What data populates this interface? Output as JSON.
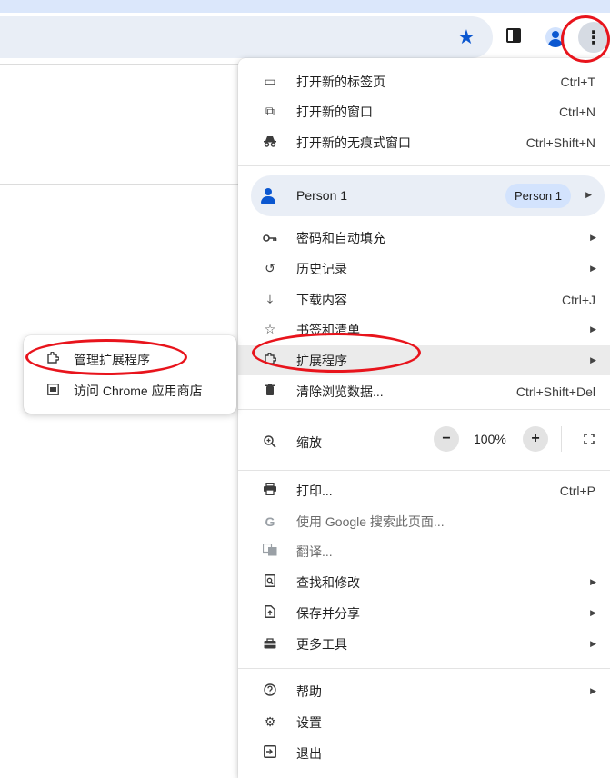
{
  "toolbar": {
    "bookmark_star_icon": "star-icon",
    "side_panel_icon": "side-panel-icon",
    "profile_icon": "profile-avatar-icon",
    "menu_icon": "more-vert-icon",
    "menu_glyph": "⋮",
    "accent": "#0b57d0"
  },
  "menu": {
    "new_tab": {
      "label": "打开新的标签页",
      "shortcut": "Ctrl+T"
    },
    "new_window": {
      "label": "打开新的窗口",
      "shortcut": "Ctrl+N"
    },
    "new_incognito": {
      "label": "打开新的无痕式窗口",
      "shortcut": "Ctrl+Shift+N"
    },
    "person": {
      "name": "Person 1",
      "chip": "Person 1"
    },
    "passwords": {
      "label": "密码和自动填充"
    },
    "history": {
      "label": "历史记录"
    },
    "downloads": {
      "label": "下载内容",
      "shortcut": "Ctrl+J"
    },
    "bookmarks": {
      "label": "书签和清单"
    },
    "extensions": {
      "label": "扩展程序"
    },
    "clear_data": {
      "label": "清除浏览数据...",
      "shortcut": "Ctrl+Shift+Del"
    },
    "zoom": {
      "label": "缩放",
      "minus": "−",
      "value": "100%",
      "plus": "+"
    },
    "print": {
      "label": "打印...",
      "shortcut": "Ctrl+P"
    },
    "google_search": {
      "label": "使用 Google 搜索此页面..."
    },
    "translate": {
      "label": "翻译..."
    },
    "find_edit": {
      "label": "查找和修改"
    },
    "save_share": {
      "label": "保存并分享"
    },
    "more_tools": {
      "label": "更多工具"
    },
    "help": {
      "label": "帮助"
    },
    "settings": {
      "label": "设置"
    },
    "exit": {
      "label": "退出"
    }
  },
  "submenu": {
    "manage_extensions": {
      "label": "管理扩展程序"
    },
    "visit_store": {
      "label": "访问 Chrome 应用商店"
    }
  },
  "annotation_color": "#e8141c"
}
